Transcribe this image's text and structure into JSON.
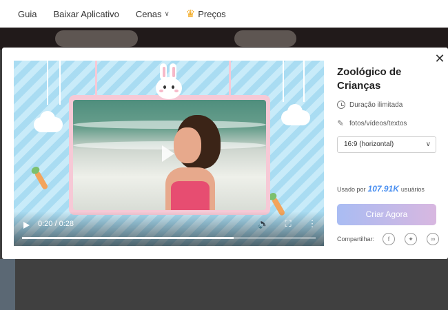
{
  "nav": {
    "items": [
      {
        "label": "Guia"
      },
      {
        "label": "Baixar Aplicativo"
      },
      {
        "label": "Cenas",
        "chevron": "chevron-down-icon"
      },
      {
        "label": "Preços",
        "icon": "crown-icon"
      }
    ]
  },
  "modal": {
    "title": "Zoológico de Crianças",
    "duration_label": "Duração ilimitada",
    "media_label": "fotos/vídeos/textos",
    "aspect_select": {
      "value": "16:9 (horizontal)"
    },
    "usage": {
      "prefix": "Usado por",
      "count": "107.91K",
      "suffix": "usuários"
    },
    "create_label": "Criar Agora",
    "share_label": "Compartilhar:",
    "share_icons": [
      "facebook-icon",
      "twitter-icon",
      "link-icon"
    ]
  },
  "video": {
    "current_time": "0:20",
    "total_time": "0:28",
    "time_text": "0:20 / 0:28",
    "progress_fraction": 0.72
  },
  "colors": {
    "accent_blue": "#4a8ff0",
    "button_gradient_start": "#a9bcf3",
    "button_gradient_end": "#d8b7e0",
    "crown": "#f2a81d"
  }
}
